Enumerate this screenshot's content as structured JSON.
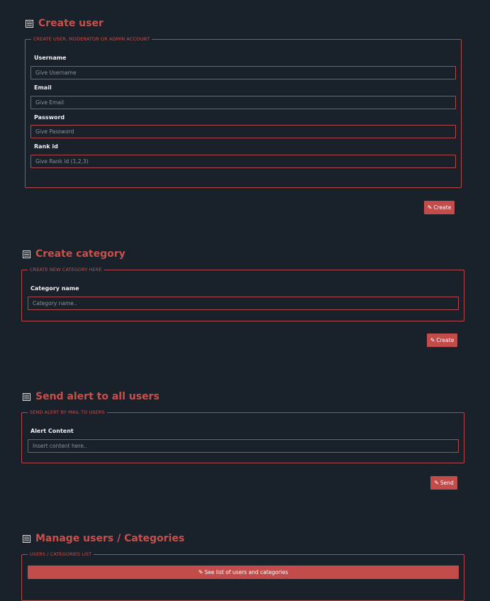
{
  "create_user": {
    "title": "Create user",
    "legend": "Create user, moderator or admin account",
    "username_label": "Username",
    "username_placeholder": "Give Username",
    "email_label": "Email",
    "email_placeholder": "Give Email",
    "password_label": "Password",
    "password_placeholder": "Give Password",
    "rank_label": "Rank id",
    "rank_placeholder": "Give Rank id (1,2,3)",
    "button_label": "Create"
  },
  "create_category": {
    "title": "Create category",
    "legend": "Create new category here",
    "name_label": "Category name",
    "name_placeholder": "Category name..",
    "button_label": "Create"
  },
  "send_alert": {
    "title": "Send alert to all users",
    "legend": "Send alert by mail to users",
    "content_label": "Alert Content",
    "content_placeholder": "Insert content here..",
    "button_label": "Send"
  },
  "manage": {
    "title": "Manage users / Categories",
    "legend": "Users / categories list",
    "button_label": "See list of users and categories"
  },
  "icons": {
    "section_icon": "list-icon",
    "button_icon": "pencil-icon"
  },
  "colors": {
    "background": "#19212b",
    "accent": "#c24c4a",
    "border": "#b5484a"
  }
}
